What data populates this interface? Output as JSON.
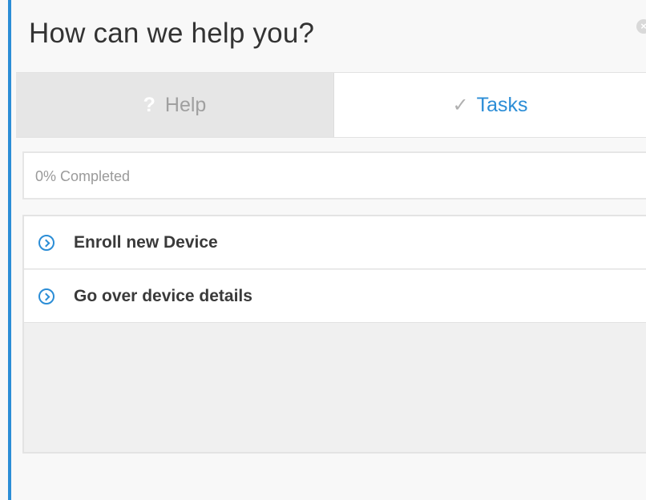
{
  "header": {
    "title": "How can we help you?",
    "close_icon": "×"
  },
  "tabs": [
    {
      "label": "Help",
      "icon": "?",
      "icon_name": "question-icon",
      "active": false
    },
    {
      "label": "Tasks",
      "icon": "✓",
      "icon_name": "check-icon",
      "active": true
    }
  ],
  "progress": {
    "text": "0% Completed",
    "percent": 0
  },
  "tasks": [
    {
      "label": "Enroll new Device",
      "icon_name": "chevron-circle-right-icon"
    },
    {
      "label": "Go over device details",
      "icon_name": "chevron-circle-right-icon"
    }
  ],
  "colors": {
    "accent": "#2b8dd6",
    "inactive_tab_bg": "#e6e6e6",
    "active_tab_bg": "#ffffff"
  }
}
